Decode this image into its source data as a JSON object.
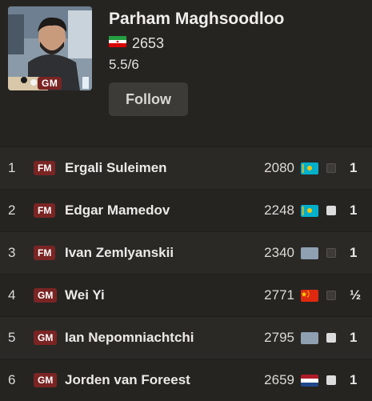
{
  "player": {
    "name": "Parham Maghsoodloo",
    "title": "GM",
    "flag": "iran-flag-icon",
    "rating": "2653",
    "score": "5.5/6",
    "follow_label": "Follow"
  },
  "colors": {
    "background": "#262421",
    "title_badge": "#7a2424",
    "button": "#3d3b38"
  },
  "games": [
    {
      "round": "1",
      "title": "FM",
      "name": "Ergali Suleimen",
      "rating": "2080",
      "flag": "kazakhstan-flag-icon",
      "color": "black",
      "result": "1"
    },
    {
      "round": "2",
      "title": "FM",
      "name": "Edgar Mamedov",
      "rating": "2248",
      "flag": "kazakhstan-flag-icon",
      "color": "white",
      "result": "1"
    },
    {
      "round": "3",
      "title": "FM",
      "name": "Ivan Zemlyanskii",
      "rating": "2340",
      "flag": "fide-flag-icon",
      "color": "black",
      "result": "1"
    },
    {
      "round": "4",
      "title": "GM",
      "name": "Wei Yi",
      "rating": "2771",
      "flag": "china-flag-icon",
      "color": "black",
      "result": "½"
    },
    {
      "round": "5",
      "title": "GM",
      "name": "Ian Nepomniachtchi",
      "rating": "2795",
      "flag": "fide-flag-icon",
      "color": "white",
      "result": "1"
    },
    {
      "round": "6",
      "title": "GM",
      "name": "Jorden van Foreest",
      "rating": "2659",
      "flag": "netherlands-flag-icon",
      "color": "white",
      "result": "1"
    }
  ]
}
